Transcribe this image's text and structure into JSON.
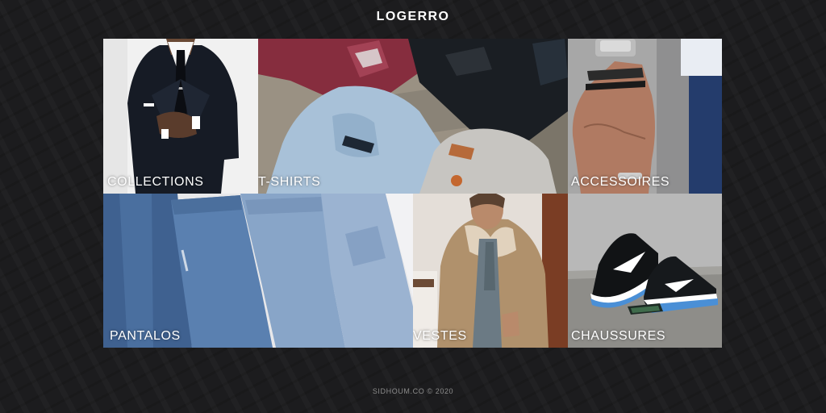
{
  "header": {
    "logo": "LOGERRO"
  },
  "tiles": [
    {
      "label": "COLLECTIONS"
    },
    {
      "label": "T-SHIRTS"
    },
    {
      "label": "ACCESSOIRES"
    },
    {
      "label": "PANTALOS"
    },
    {
      "label": "VESTES"
    },
    {
      "label": "CHAUSSURES"
    }
  ],
  "footer": {
    "text": "SIDHOUM.CO © 2020"
  }
}
